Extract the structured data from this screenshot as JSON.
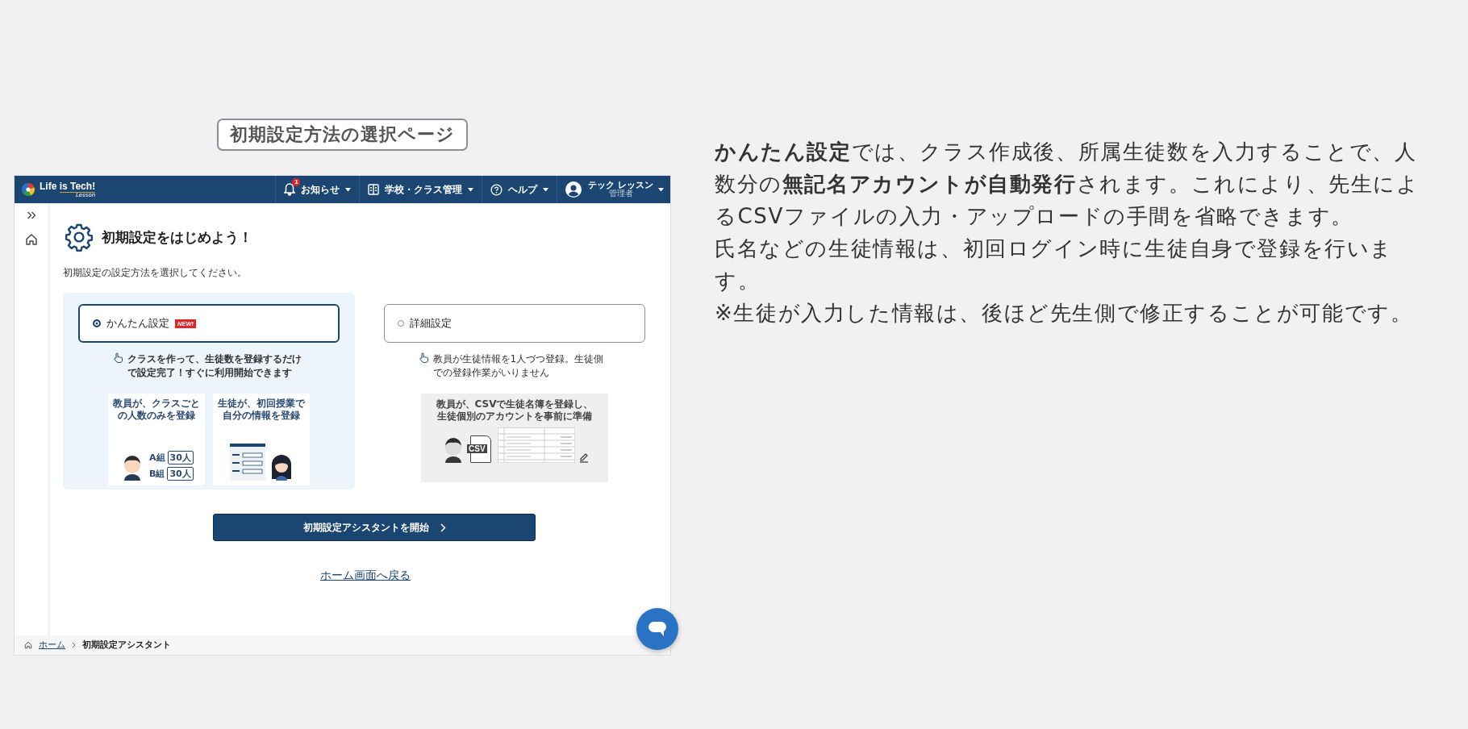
{
  "caption": "初期設定方法の選択ページ",
  "app": {
    "header": {
      "logo": "Life is Tech!",
      "logo_sub": "Lesson",
      "nav": [
        {
          "kind": "notifications",
          "label": "お知らせ",
          "badge": "1"
        },
        {
          "kind": "school",
          "label": "学校・クラス管理"
        },
        {
          "kind": "help",
          "label": "ヘルプ"
        }
      ],
      "user": {
        "name": "テック レッスン",
        "role": "管理者"
      }
    },
    "sidebar": {
      "items": [
        {
          "kind": "expand"
        },
        {
          "kind": "home"
        }
      ]
    },
    "page": {
      "title": "初期設定をはじめよう！",
      "subtitle": "初期設定の設定方法を選択してください。",
      "options": [
        {
          "label": "かんたん設定",
          "badge": "NEW!",
          "selected": true,
          "description": "クラスを作って、生徒数を登録するだけで設定完了！すぐに利用開始できます",
          "illustrations": [
            {
              "kind": "teacher_classes",
              "caption": "教員が、クラスごとの人数のみを登録",
              "rows": [
                {
                  "label": "A組",
                  "value": "30人"
                },
                {
                  "label": "B組",
                  "value": "30人"
                }
              ]
            },
            {
              "kind": "student_form",
              "caption": "生徒が、初回授業で自分の情報を登録"
            }
          ]
        },
        {
          "label": "詳細設定",
          "selected": false,
          "description": "教員が生徒情報を1人づつ登録。生徒側での登録作業がいりません",
          "illustrations": [
            {
              "kind": "csv_roster",
              "caption": "教員が、CSVで生徒名簿を登録し、生徒個別のアカウントを事前に準備",
              "file_label": "CSV"
            }
          ]
        }
      ],
      "start_button": "初期設定アシスタントを開始",
      "back_link": "ホーム画面へ戻る"
    },
    "breadcrumb": [
      {
        "label": "ホーム",
        "link": true
      },
      {
        "label": "初期設定アシスタント",
        "link": false
      }
    ]
  },
  "explanation": [
    "**かんたん設定**では、クラス作成後、所属生徒数を入力することで、人数分の**無記名アカウントが自動発行**されます。これにより、先生によるCSVファイルの入力・アップロードの手間を省略できます。",
    "氏名などの生徒情報は、初回ログイン時に生徒自身で登録を行います。",
    "※生徒が入力した情報は、後ほど先生側で修正することが可能です。"
  ]
}
